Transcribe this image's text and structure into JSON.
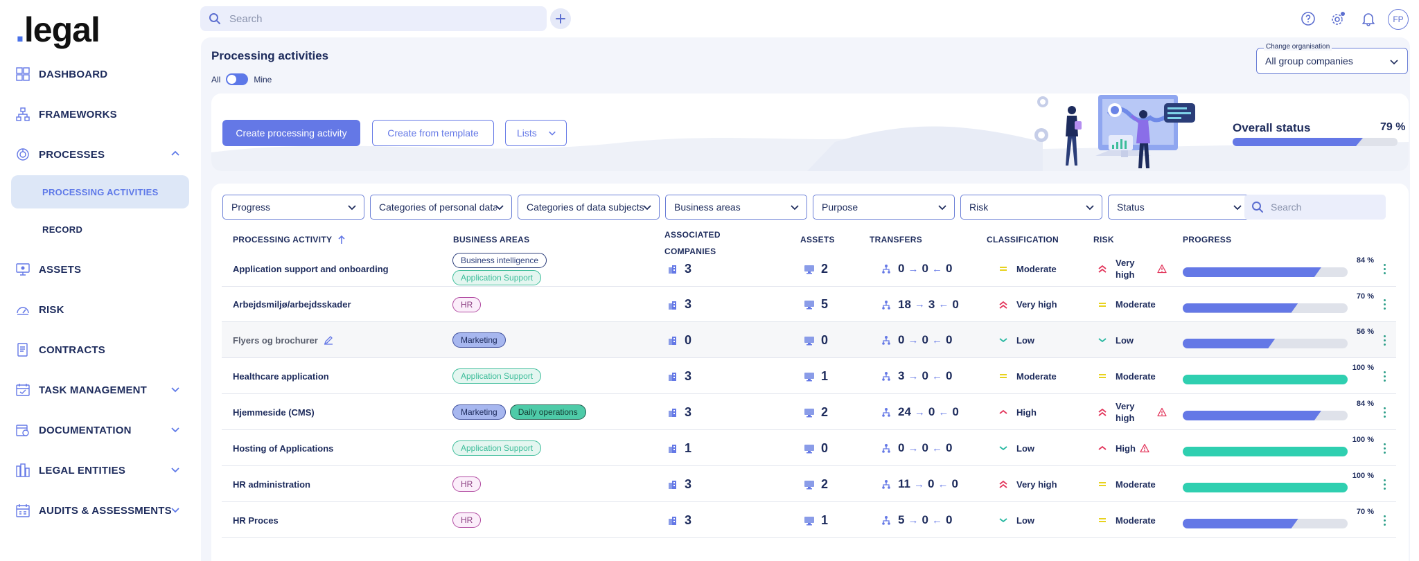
{
  "logo": {
    "dot": ".",
    "text": "legal"
  },
  "sidebar": {
    "items": [
      {
        "label": "DASHBOARD",
        "icon": "dashboard-icon"
      },
      {
        "label": "FRAMEWORKS",
        "icon": "frameworks-icon"
      },
      {
        "label": "PROCESSES",
        "icon": "processes-icon"
      },
      {
        "label": "ASSETS",
        "icon": "assets-icon"
      },
      {
        "label": "RISK",
        "icon": "risk-icon"
      },
      {
        "label": "CONTRACTS",
        "icon": "contracts-icon"
      },
      {
        "label": "TASK MANAGEMENT",
        "icon": "task-icon"
      },
      {
        "label": "DOCUMENTATION",
        "icon": "documentation-icon"
      },
      {
        "label": "LEGAL ENTITIES",
        "icon": "legal-entities-icon"
      },
      {
        "label": "AUDITS & ASSESSMENTS",
        "icon": "audits-icon"
      }
    ],
    "sub_items": [
      {
        "label": "PROCESSING ACTIVITIES",
        "active": true
      },
      {
        "label": "RECORD",
        "active": false
      }
    ]
  },
  "topbar": {
    "search_placeholder": "Search",
    "avatar_initials": "FP"
  },
  "page": {
    "title": "Processing activities",
    "toggle_all": "All",
    "toggle_mine": "Mine",
    "org_legend": "Change organisation",
    "org_value": "All group companies"
  },
  "hero": {
    "create_button": "Create processing activity",
    "template_button": "Create from template",
    "lists_button": "Lists",
    "overall_label": "Overall status",
    "overall_pct": "79 %",
    "overall_value": 0.79
  },
  "filters": [
    "Progress",
    "Categories of personal data",
    "Categories of data subjects",
    "Business areas",
    "Purpose",
    "Risk",
    "Status"
  ],
  "filter_search_placeholder": "Search",
  "table": {
    "headers": {
      "activity": "PROCESSING ACTIVITY",
      "business": "BUSINESS AREAS",
      "companies_1": "ASSOCIATED",
      "companies_2": "COMPANIES",
      "assets": "ASSETS",
      "transfers": "TRANSFERS",
      "classification": "CLASSIFICATION",
      "risk": "RISK",
      "progress": "PROGRESS"
    },
    "rows": [
      {
        "name": "Application support and onboarding",
        "tags": [
          [
            "Business intelligence",
            "bi"
          ],
          [
            "Application Support",
            "app"
          ]
        ],
        "companies": "3",
        "assets": "2",
        "t1": "0",
        "t2": "0",
        "t3": "0",
        "classification": "Moderate",
        "cls_level": "moderate",
        "risk": "Very high",
        "risk_level": "very-high",
        "risk_warn": true,
        "progress_label": "84 %",
        "progress": 0.84
      },
      {
        "name": "Arbejdsmiljø/arbejdsskader",
        "tags": [
          [
            "HR",
            "hr"
          ]
        ],
        "companies": "3",
        "assets": "5",
        "t1": "18",
        "t2": "3",
        "t3": "0",
        "classification": "Very high",
        "cls_level": "very-high",
        "risk": "Moderate",
        "risk_level": "moderate",
        "risk_warn": false,
        "progress_label": "70 %",
        "progress": 0.7
      },
      {
        "name": "Flyers og brochurer",
        "tags": [
          [
            "Marketing",
            "mk"
          ]
        ],
        "companies": "0",
        "assets": "0",
        "t1": "0",
        "t2": "0",
        "t3": "0",
        "classification": "Low",
        "cls_level": "low",
        "risk": "Low",
        "risk_level": "low",
        "risk_warn": false,
        "progress_label": "56 %",
        "progress": 0.56,
        "muted": true
      },
      {
        "name": "Healthcare application",
        "tags": [
          [
            "Application Support",
            "app"
          ]
        ],
        "companies": "3",
        "assets": "1",
        "t1": "3",
        "t2": "0",
        "t3": "0",
        "classification": "Moderate",
        "cls_level": "moderate",
        "risk": "Moderate",
        "risk_level": "moderate",
        "risk_warn": false,
        "progress_label": "100 %",
        "progress": 1.0
      },
      {
        "name": "Hjemmeside (CMS)",
        "tags": [
          [
            "Marketing",
            "mk"
          ],
          [
            "Daily operations",
            "daily"
          ]
        ],
        "companies": "3",
        "assets": "2",
        "t1": "24",
        "t2": "0",
        "t3": "0",
        "classification": "High",
        "cls_level": "high",
        "risk": "Very high",
        "risk_level": "very-high",
        "risk_warn": true,
        "progress_label": "84 %",
        "progress": 0.84
      },
      {
        "name": "Hosting of Applications",
        "tags": [
          [
            "Application Support",
            "app"
          ]
        ],
        "companies": "1",
        "assets": "0",
        "t1": "0",
        "t2": "0",
        "t3": "0",
        "classification": "Low",
        "cls_level": "low",
        "risk": "High",
        "risk_level": "high",
        "risk_warn": true,
        "progress_label": "100 %",
        "progress": 1.0
      },
      {
        "name": "HR administration",
        "tags": [
          [
            "HR",
            "hr"
          ]
        ],
        "companies": "3",
        "assets": "2",
        "t1": "11",
        "t2": "0",
        "t3": "0",
        "classification": "Very high",
        "cls_level": "very-high",
        "risk": "Moderate",
        "risk_level": "moderate",
        "risk_warn": false,
        "progress_label": "100 %",
        "progress": 1.0
      },
      {
        "name": "HR Proces",
        "tags": [
          [
            "HR",
            "hr"
          ]
        ],
        "companies": "3",
        "assets": "1",
        "t1": "5",
        "t2": "0",
        "t3": "0",
        "classification": "Low",
        "cls_level": "low",
        "risk": "Moderate",
        "risk_level": "moderate",
        "risk_warn": false,
        "progress_label": "70 %",
        "progress": 0.7
      }
    ]
  },
  "colors": {
    "accent": "#6478e6",
    "teal": "#2fcfb0",
    "danger": "#e2345a",
    "warn": "#e8d21e",
    "low": "#26b7a0"
  }
}
